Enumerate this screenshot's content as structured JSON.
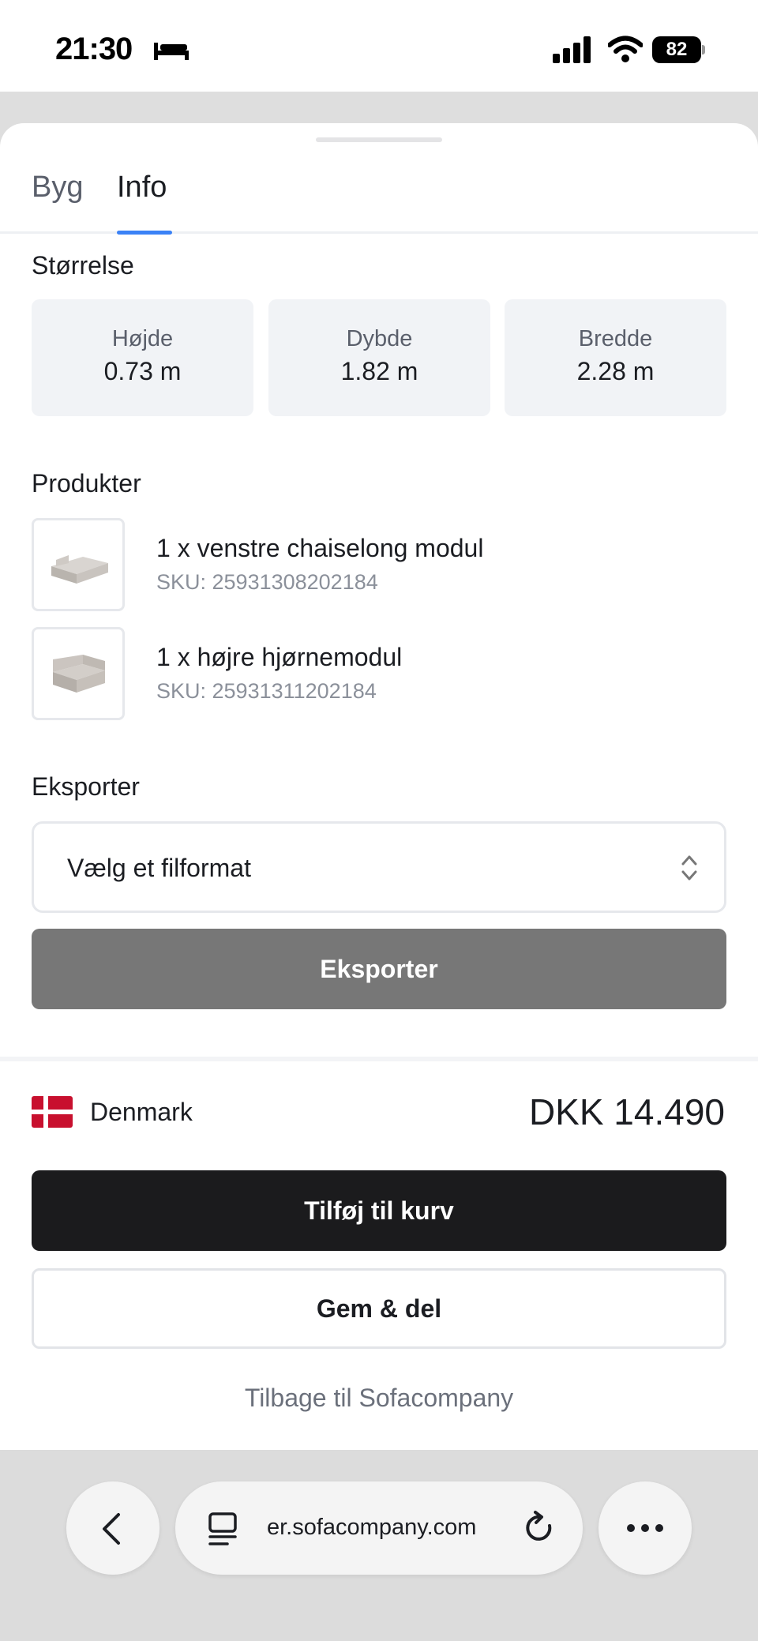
{
  "status_bar": {
    "time": "21:30",
    "battery": "82"
  },
  "tabs": [
    {
      "label": "Byg",
      "active": false
    },
    {
      "label": "Info",
      "active": true
    }
  ],
  "size": {
    "title": "Størrelse",
    "dimensions": [
      {
        "label": "Højde",
        "value": "0.73 m"
      },
      {
        "label": "Dybde",
        "value": "1.82 m"
      },
      {
        "label": "Bredde",
        "value": "2.28 m"
      }
    ]
  },
  "products": {
    "title": "Produkter",
    "items": [
      {
        "name": "1 x venstre chaiselong modul",
        "sku": "SKU: 25931308202184"
      },
      {
        "name": "1 x højre hjørnemodul",
        "sku": "SKU: 25931311202184"
      }
    ]
  },
  "export": {
    "title": "Eksporter",
    "select_value": "Vælg et filformat",
    "button_label": "Eksporter"
  },
  "checkout": {
    "country": "Denmark",
    "price": "DKK 14.490",
    "add_to_cart_label": "Tilføj til kurv",
    "save_share_label": "Gem & del",
    "back_link": "Tilbage til Sofacompany"
  },
  "browser": {
    "url": "er.sofacompany.com"
  },
  "colors": {
    "accent": "#3b82f6",
    "primary_button": "#1b1b1d",
    "disabled_button": "#777777",
    "flag_red": "#c8102e"
  }
}
